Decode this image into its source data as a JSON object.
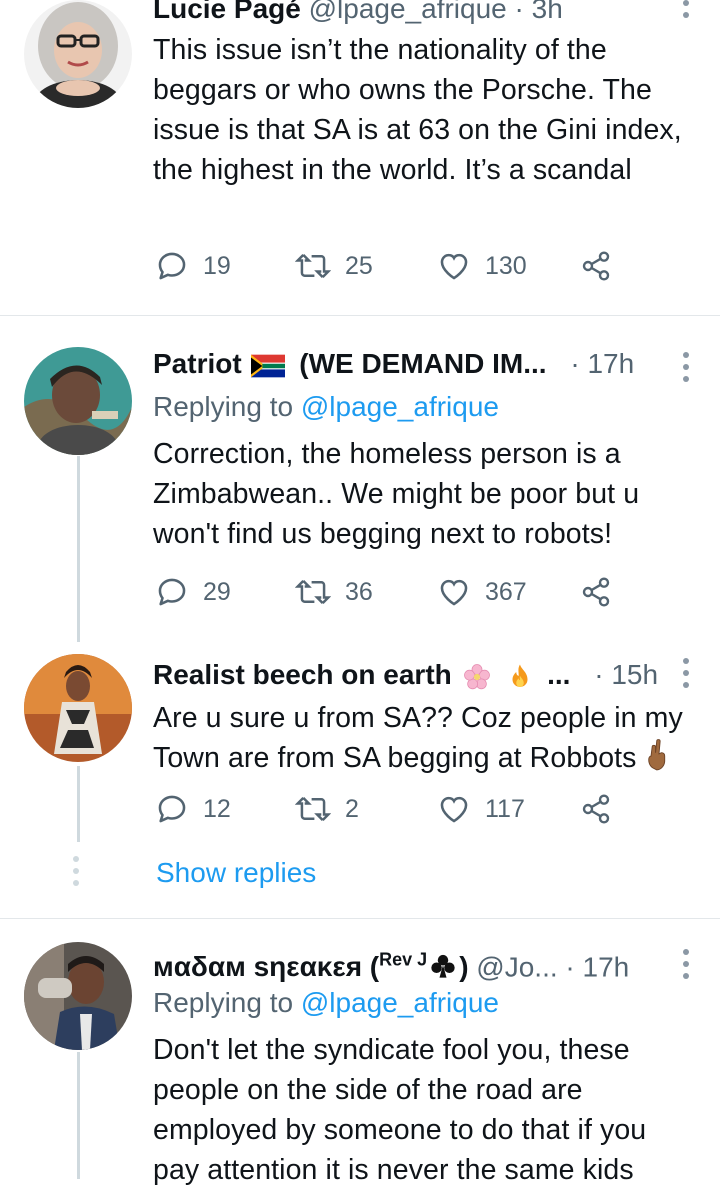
{
  "tweets": [
    {
      "name": "Lucie Pagé",
      "handle": "@lpage_afrique",
      "time": "· 3h",
      "text": "This issue isn’t the nationality of the beggars or who owns the Porsche. The issue is that SA is at 63 on the Gini index, the highest in the world. It’s a scandal",
      "replies": "19",
      "retweets": "25",
      "likes": "130"
    },
    {
      "name": "Patriot",
      "name_suffix": "(WE DEMAND IM...",
      "time": "· 17h",
      "replying_prefix": "Replying to",
      "replying_handle": "@lpage_afrique",
      "text": "Correction, the homeless person is a Zimbabwean.. We might be poor but u won't find us begging next to robots!",
      "replies": "29",
      "retweets": "36",
      "likes": "367"
    },
    {
      "name": "Realist beech on earth",
      "name_suffix": "...",
      "time": "· 15h",
      "text": "Are u sure u from SA?? Coz people in my Town are from SA begging at Robbots",
      "replies": "12",
      "retweets": "2",
      "likes": "117"
    },
    {
      "name": "мαδαм sηεακεя (",
      "name_sup": "Rev J",
      "name_end": ")",
      "handle": "@Jo...",
      "time": "· 17h",
      "replying_prefix": "Replying to",
      "replying_handle": "@lpage_afrique",
      "text": "Don't let the syndicate fool you, these people on the side of the road are employed by someone to do that if you pay attention it is never the same kids"
    }
  ],
  "show_replies": "Show replies",
  "colors": {
    "accent": "#1d9bf0",
    "muted": "#536471",
    "divider": "#e3e7ea"
  }
}
